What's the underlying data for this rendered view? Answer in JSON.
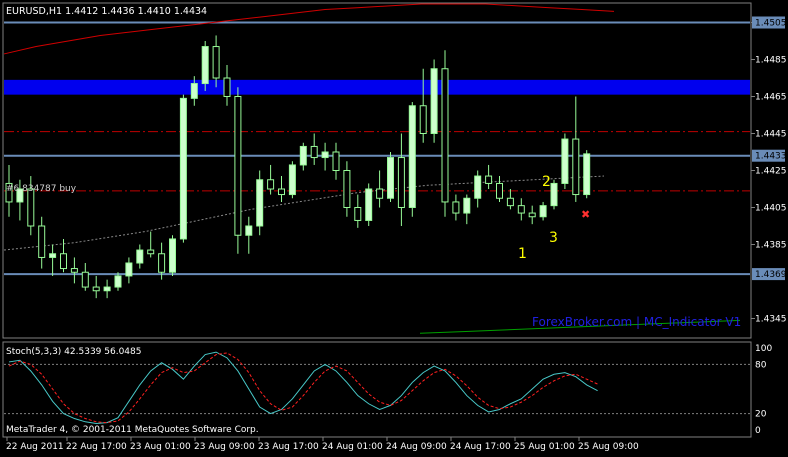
{
  "window": {
    "symbol_header": "EURUSD,H1  1.4412 1.4436 1.4410 1.4434",
    "watermark": "ForexBroker.com | MC_Indicator V1",
    "copyright": "MetaTrader 4, © 2001-2011 MetaQuotes Software Corp.",
    "order_label": "#6 834787 buy"
  },
  "price_axis": {
    "ticks": [
      "1.4505",
      "1.4485",
      "1.4465",
      "1.4445",
      "1.4425",
      "1.4405",
      "1.4385",
      "1.4345"
    ],
    "highlight_labels": [
      "1.4505",
      "1.4433",
      "1.4369"
    ]
  },
  "time_axis": {
    "labels": [
      "22 Aug 2011",
      "22 Aug 17:00",
      "23 Aug 01:00",
      "23 Aug 09:00",
      "23 Aug 17:00",
      "24 Aug 01:00",
      "24 Aug 09:00",
      "24 Aug 17:00",
      "25 Aug 01:00",
      "25 Aug 09:00"
    ]
  },
  "annotations": {
    "wave_labels": [
      "1",
      "2",
      "3"
    ]
  },
  "stoch": {
    "title": "Stoch(5,3,3) 42.5339 56.0485",
    "axis_ticks": [
      "100",
      "80",
      "20",
      "0"
    ],
    "main": [
      83,
      85,
      72,
      55,
      35,
      20,
      14,
      10,
      8,
      9,
      15,
      35,
      55,
      72,
      82,
      74,
      62,
      78,
      92,
      95,
      88,
      72,
      50,
      28,
      20,
      25,
      38,
      55,
      72,
      80,
      72,
      58,
      42,
      32,
      25,
      30,
      42,
      58,
      70,
      78,
      72,
      58,
      42,
      30,
      22,
      25,
      32,
      38,
      50,
      62,
      68,
      70,
      65,
      55,
      48
    ],
    "signal": [
      78,
      84,
      80,
      68,
      50,
      32,
      20,
      14,
      10,
      9,
      11,
      22,
      38,
      55,
      70,
      76,
      70,
      72,
      82,
      92,
      94,
      86,
      70,
      48,
      32,
      24,
      28,
      42,
      58,
      72,
      78,
      72,
      58,
      44,
      34,
      30,
      36,
      48,
      60,
      70,
      74,
      66,
      54,
      40,
      30,
      26,
      28,
      34,
      42,
      52,
      60,
      66,
      68,
      62,
      56
    ]
  },
  "colors": {
    "background": "#000000",
    "grid": "#808080",
    "bull_candle": "#ccffcc",
    "bear_candle": "#000000",
    "candle_wick": "#98fb98",
    "blue_band": "#0000ee",
    "level_line": "#6a8cb8",
    "red_dashdot": "#c00000",
    "ma_red": "#d00000",
    "ma_green": "#00a000",
    "dashed_ma": "#888888",
    "stoch_main": "#48c8c8",
    "stoch_signal": "#ff2020",
    "wave_labels": "#ffff00",
    "watermark": "#2020e0"
  },
  "chart_data": {
    "type": "candlestick",
    "symbol": "EURUSD",
    "timeframe": "H1",
    "candles": [
      [
        1.4418,
        1.4428,
        1.44,
        1.4408
      ],
      [
        1.4408,
        1.442,
        1.4398,
        1.4415
      ],
      [
        1.4415,
        1.4422,
        1.439,
        1.4395
      ],
      [
        1.4395,
        1.44,
        1.4372,
        1.4378
      ],
      [
        1.4378,
        1.4385,
        1.4368,
        1.438
      ],
      [
        1.438,
        1.4388,
        1.437,
        1.4372
      ],
      [
        1.4372,
        1.4378,
        1.4364,
        1.437
      ],
      [
        1.437,
        1.4375,
        1.436,
        1.4362
      ],
      [
        1.4362,
        1.4368,
        1.4356,
        1.436
      ],
      [
        1.436,
        1.4366,
        1.4356,
        1.4362
      ],
      [
        1.4362,
        1.437,
        1.436,
        1.4368
      ],
      [
        1.4368,
        1.4378,
        1.4364,
        1.4375
      ],
      [
        1.4375,
        1.4385,
        1.4372,
        1.4382
      ],
      [
        1.4382,
        1.4392,
        1.4378,
        1.438
      ],
      [
        1.438,
        1.4386,
        1.4366,
        1.437
      ],
      [
        1.437,
        1.439,
        1.4368,
        1.4388
      ],
      [
        1.4388,
        1.4466,
        1.4386,
        1.4464
      ],
      [
        1.4464,
        1.4476,
        1.446,
        1.4472
      ],
      [
        1.4472,
        1.4495,
        1.4468,
        1.4492
      ],
      [
        1.4492,
        1.4498,
        1.447,
        1.4475
      ],
      [
        1.4475,
        1.4482,
        1.446,
        1.4465
      ],
      [
        1.4465,
        1.447,
        1.438,
        1.439
      ],
      [
        1.439,
        1.44,
        1.438,
        1.4395
      ],
      [
        1.4395,
        1.4425,
        1.439,
        1.442
      ],
      [
        1.442,
        1.4428,
        1.4412,
        1.4415
      ],
      [
        1.4415,
        1.4422,
        1.4408,
        1.4412
      ],
      [
        1.4412,
        1.443,
        1.441,
        1.4428
      ],
      [
        1.4428,
        1.444,
        1.4425,
        1.4438
      ],
      [
        1.4438,
        1.4445,
        1.4428,
        1.4432
      ],
      [
        1.4432,
        1.444,
        1.4425,
        1.4435
      ],
      [
        1.4435,
        1.444,
        1.442,
        1.4425
      ],
      [
        1.4425,
        1.443,
        1.44,
        1.4405
      ],
      [
        1.4405,
        1.4412,
        1.4394,
        1.4398
      ],
      [
        1.4398,
        1.4418,
        1.4395,
        1.4415
      ],
      [
        1.4415,
        1.4425,
        1.4405,
        1.441
      ],
      [
        1.441,
        1.4435,
        1.4408,
        1.4432
      ],
      [
        1.4432,
        1.4445,
        1.4395,
        1.4405
      ],
      [
        1.4405,
        1.4462,
        1.44,
        1.446
      ],
      [
        1.446,
        1.448,
        1.444,
        1.4445
      ],
      [
        1.4445,
        1.4485,
        1.444,
        1.448
      ],
      [
        1.448,
        1.449,
        1.44,
        1.4408
      ],
      [
        1.4408,
        1.4412,
        1.4398,
        1.4402
      ],
      [
        1.4402,
        1.4412,
        1.4396,
        1.441
      ],
      [
        1.441,
        1.4425,
        1.4405,
        1.4422
      ],
      [
        1.4422,
        1.4428,
        1.4415,
        1.4418
      ],
      [
        1.4418,
        1.4422,
        1.4408,
        1.441
      ],
      [
        1.441,
        1.4415,
        1.4404,
        1.4406
      ],
      [
        1.4406,
        1.441,
        1.4398,
        1.4402
      ],
      [
        1.4402,
        1.4406,
        1.4396,
        1.44
      ],
      [
        1.44,
        1.4408,
        1.4398,
        1.4406
      ],
      [
        1.4406,
        1.442,
        1.4404,
        1.4418
      ],
      [
        1.4418,
        1.4445,
        1.4415,
        1.4442
      ],
      [
        1.4442,
        1.4465,
        1.4408,
        1.4412
      ],
      [
        1.4412,
        1.4436,
        1.441,
        1.4434
      ]
    ],
    "ylim": [
      1.4335,
      1.4515
    ],
    "horizontal_levels": [
      1.4505,
      1.4433,
      1.4369
    ],
    "blue_band": [
      1.4466,
      1.4474
    ],
    "dashdot_levels": [
      1.4446,
      1.4414
    ]
  }
}
